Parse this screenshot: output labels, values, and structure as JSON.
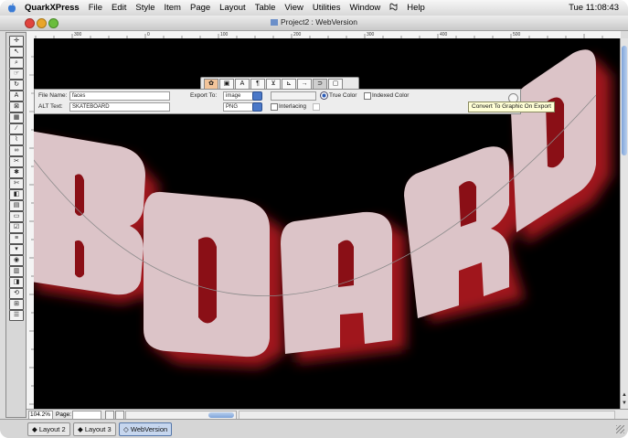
{
  "menubar": {
    "app_name": "QuarkXPress",
    "items": [
      "File",
      "Edit",
      "Style",
      "Item",
      "Page",
      "Layout",
      "Table",
      "View",
      "Utilities",
      "Window",
      "Help"
    ],
    "clock": "Tue 11:08:43"
  },
  "window": {
    "title": "Project2 : WebVersion"
  },
  "ruler": {
    "marks": [
      "300",
      "0",
      "100",
      "200",
      "300",
      "400",
      "500"
    ]
  },
  "measurements": {
    "file_name_label": "File Name:",
    "file_name_value": "faces",
    "alt_text_label": "ALT Text:",
    "alt_text_value": "SKATEBOARD",
    "export_to_label": "Export To:",
    "export_to_value": "image",
    "format_value": "PNG",
    "true_color_label": "True Color",
    "indexed_color_label": "Indexed Color",
    "interlacing_label": "Interlacing"
  },
  "tooltip": "Convert To Graphic On Export",
  "artwork": {
    "word": "BOARD",
    "letters": [
      "B",
      "O",
      "A",
      "R",
      "D"
    ]
  },
  "status": {
    "zoom": "104.2%",
    "page_label": "Page:"
  },
  "layout_tabs": [
    "Layout 2",
    "Layout 3",
    "WebVersion"
  ],
  "colors": {
    "canvas": "#000000",
    "letter_fill": "#dcc4c8",
    "letter_shadow": "#a0141a",
    "active_tab": "#c6d6ee"
  }
}
